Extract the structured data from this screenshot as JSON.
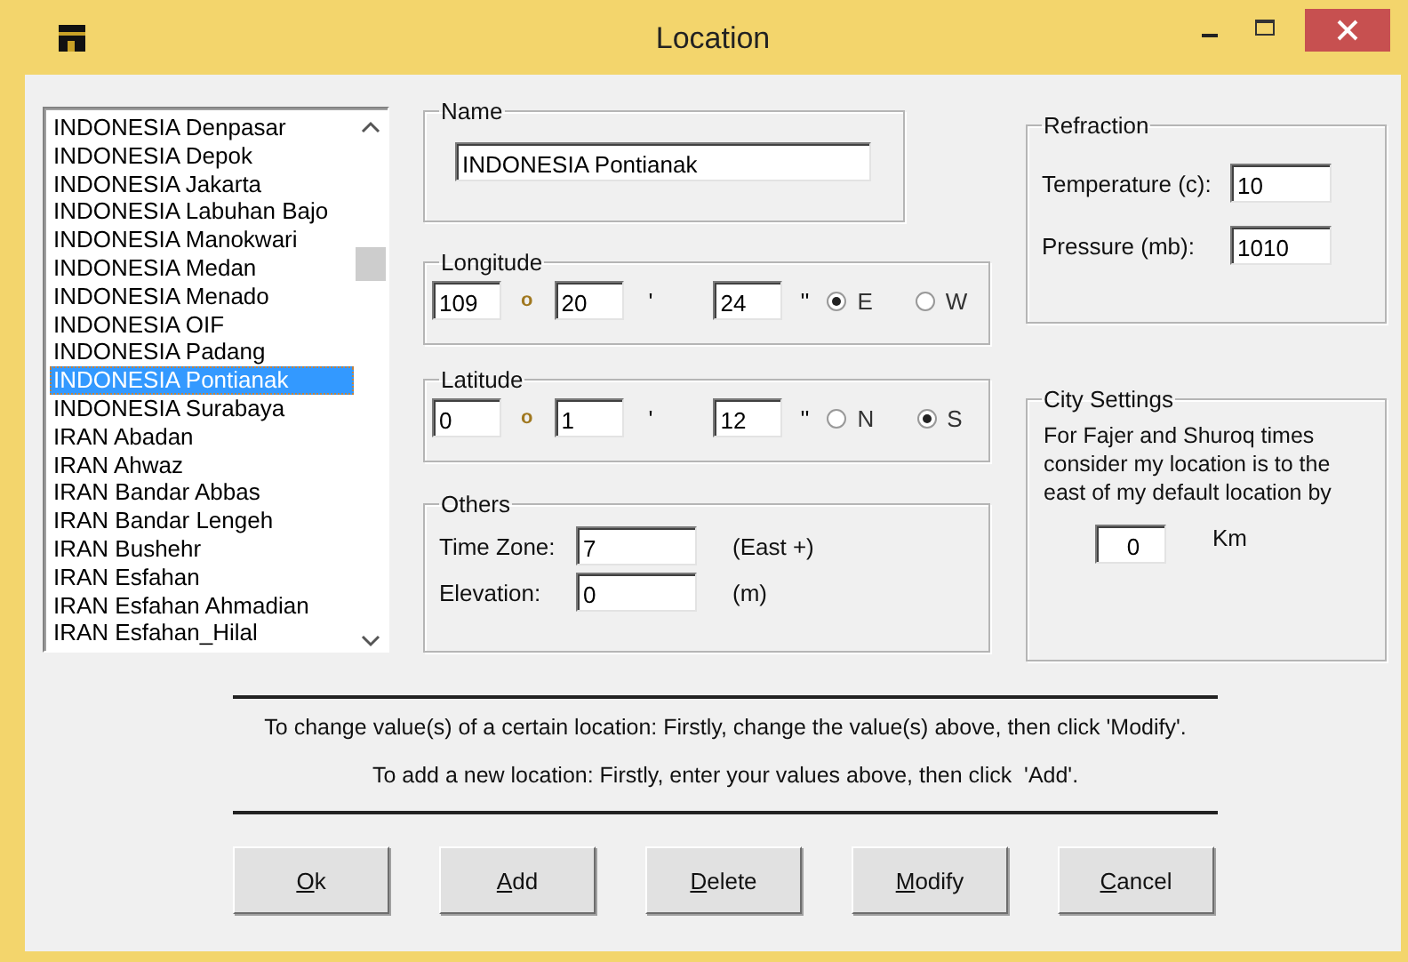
{
  "window": {
    "title": "Location"
  },
  "locations": [
    {
      "name": "INDONESIA Denpasar",
      "selected": false
    },
    {
      "name": "INDONESIA Depok",
      "selected": false
    },
    {
      "name": "INDONESIA Jakarta",
      "selected": false
    },
    {
      "name": "INDONESIA Labuhan Bajo",
      "selected": false
    },
    {
      "name": "INDONESIA Manokwari",
      "selected": false
    },
    {
      "name": "INDONESIA Medan",
      "selected": false
    },
    {
      "name": "INDONESIA Menado",
      "selected": false
    },
    {
      "name": "INDONESIA OIF",
      "selected": false
    },
    {
      "name": "INDONESIA Padang",
      "selected": false
    },
    {
      "name": "INDONESIA Pontianak",
      "selected": true
    },
    {
      "name": "INDONESIA Surabaya",
      "selected": false
    },
    {
      "name": "IRAN Abadan",
      "selected": false
    },
    {
      "name": "IRAN Ahwaz",
      "selected": false
    },
    {
      "name": "IRAN Bandar Abbas",
      "selected": false
    },
    {
      "name": "IRAN Bandar Lengeh",
      "selected": false
    },
    {
      "name": "IRAN Bushehr",
      "selected": false
    },
    {
      "name": "IRAN Esfahan",
      "selected": false
    },
    {
      "name": "IRAN Esfahan Ahmadian",
      "selected": false
    },
    {
      "name": "IRAN Esfahan_Hilal",
      "selected": false
    }
  ],
  "name_group": {
    "label": "Name",
    "value": "INDONESIA Pontianak"
  },
  "longitude": {
    "label": "Longitude",
    "degrees": "109",
    "degree_sign": "o",
    "minutes": "20",
    "minute_sign": "'",
    "seconds": "24",
    "second_sign": "''",
    "options": [
      {
        "label": "E",
        "selected": true
      },
      {
        "label": "W",
        "selected": false
      }
    ]
  },
  "latitude": {
    "label": "Latitude",
    "degrees": "0",
    "degree_sign": "o",
    "minutes": "1",
    "minute_sign": "'",
    "seconds": "12",
    "second_sign": "''",
    "options": [
      {
        "label": "N",
        "selected": false
      },
      {
        "label": "S",
        "selected": true
      }
    ]
  },
  "others": {
    "label": "Others",
    "rows": [
      {
        "label": "Time Zone:",
        "value": "7",
        "unit": "(East +)"
      },
      {
        "label": "Elevation:",
        "value": "0",
        "unit": "(m)"
      }
    ]
  },
  "refraction": {
    "label": "Refraction",
    "rows": [
      {
        "label": "Temperature (c):",
        "value": "10"
      },
      {
        "label": "Pressure (mb):",
        "value": "1010"
      }
    ]
  },
  "city_settings": {
    "label": "City Settings",
    "text": "For Fajer and Shuroq times consider my location is to the east of my default location by",
    "value": "0",
    "unit": "Km"
  },
  "instructions": [
    "To change value(s) of a certain location: Firstly, change the value(s) above, then click 'Modify'.",
    "To add a new location: Firstly, enter your values above, then click  'Add'."
  ],
  "buttons": [
    {
      "key": "O",
      "rest": "k"
    },
    {
      "key": "A",
      "rest": "dd"
    },
    {
      "key": "D",
      "rest": "elete"
    },
    {
      "key": "M",
      "rest": "odify"
    },
    {
      "key": "C",
      "rest": "ancel"
    }
  ]
}
